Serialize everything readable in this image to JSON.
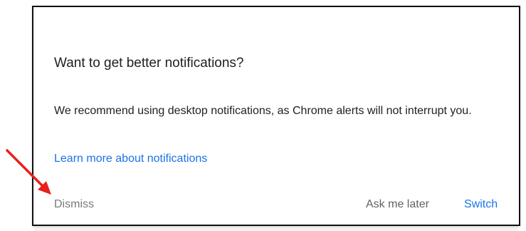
{
  "dialog": {
    "title": "Want to get better notifications?",
    "body": "We recommend using desktop notifications, as Chrome alerts will not interrupt you.",
    "learn_more_link": "Learn more about notifications",
    "buttons": {
      "dismiss": "Dismiss",
      "ask_later": "Ask me later",
      "switch": "Switch"
    }
  },
  "annotation": {
    "arrow_color": "#e8201a",
    "points_to": "dismiss-button"
  },
  "colors": {
    "accent": "#1a73e8",
    "text": "#202124",
    "muted": "#7a7a7a"
  }
}
